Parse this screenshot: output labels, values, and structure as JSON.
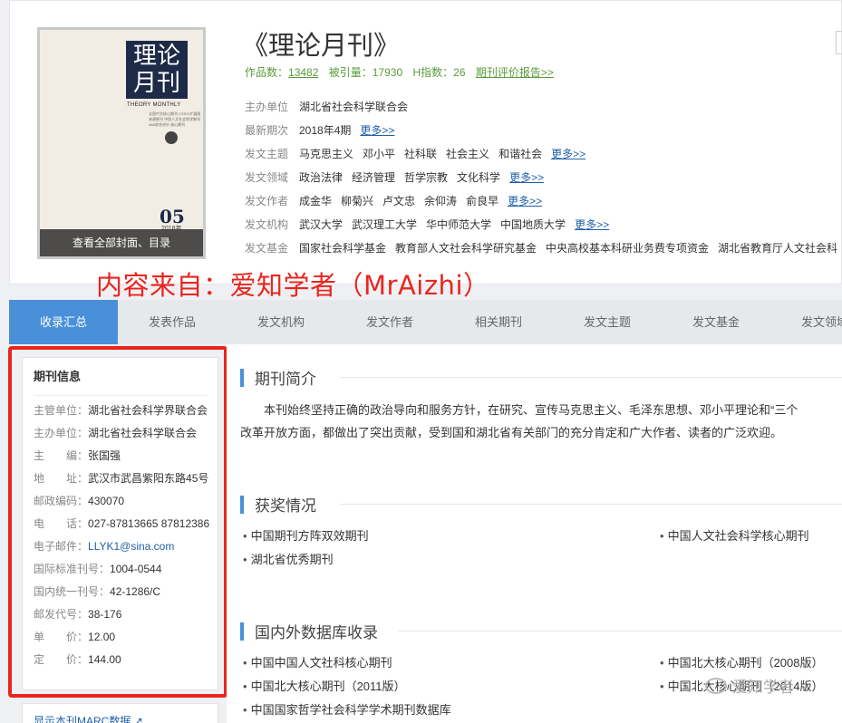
{
  "journal": {
    "title": "《理论月刊》",
    "stats": {
      "works_label": "作品数：",
      "works_value": "13482",
      "citations_label": "被引量：",
      "citations_value": "17930",
      "hindex_label": "H指数：",
      "hindex_value": "26",
      "report_link": "期刊评价报告>>"
    },
    "cover": {
      "chinese_title": "理论月刊",
      "english_title": "THEORY MONTHLY",
      "tiny_text": "全国中文核心期刊 CSSCI扩展版来源期刊 中国人文社会科学期刊AMI综合评价 核心期刊",
      "issue": "05",
      "year": "2018年",
      "overlay_text": "查看全部封面、目录"
    }
  },
  "meta_rows": [
    {
      "label": "主办单位",
      "values": [
        "湖北省社会科学联合会"
      ],
      "more": ""
    },
    {
      "label": "最新期次",
      "values": [
        "2018年4期"
      ],
      "more": "更多>>"
    },
    {
      "label": "发文主题",
      "values": [
        "马克思主义",
        "邓小平",
        "社科联",
        "社会主义",
        "和谐社会"
      ],
      "more": "更多>>"
    },
    {
      "label": "发文领域",
      "values": [
        "政治法律",
        "经济管理",
        "哲学宗教",
        "文化科学"
      ],
      "more": "更多>>"
    },
    {
      "label": "发文作者",
      "values": [
        "成金华",
        "柳菊兴",
        "卢文忠",
        "余仰涛",
        "俞良早"
      ],
      "more": "更多>>"
    },
    {
      "label": "发文机构",
      "values": [
        "武汉大学",
        "武汉理工大学",
        "华中师范大学",
        "中国地质大学"
      ],
      "more": "更多>>"
    },
    {
      "label": "发文基金",
      "values": [
        "国家社会科学基金",
        "教育部人文社会科学研究基金",
        "中央高校基本科研业务费专项资金",
        "湖北省教育厅人文社会科"
      ],
      "more": ""
    }
  ],
  "red_caption": "内容来自：爱知学者（MrAizhi）",
  "tabs": [
    "收录汇总",
    "发表作品",
    "发文机构",
    "发文作者",
    "相关期刊",
    "发文主题",
    "发文基金",
    "发文领域"
  ],
  "sidebar": {
    "heading": "期刊信息",
    "rows": [
      {
        "k": "主管单位：",
        "v": "湖北省社会科学界联合会"
      },
      {
        "k": "主办单位：",
        "v": "湖北省社会科学联合会"
      },
      {
        "k": "主　　编：",
        "v": "张国强"
      },
      {
        "k": "地　　址：",
        "v": "武汉市武昌紫阳东路45号"
      },
      {
        "k": "邮政编码：",
        "v": "430070"
      },
      {
        "k": "电　　话：",
        "v": "027-87813665 87812386"
      },
      {
        "k": "电子邮件：",
        "v": "LLYK1@sina.com"
      },
      {
        "k": "国际标准刊号：",
        "v": "1004-0544"
      },
      {
        "k": "国内统一刊号：",
        "v": "42-1286/C"
      },
      {
        "k": "邮发代号：",
        "v": "38-176"
      },
      {
        "k": "单　　价：",
        "v": "12.00"
      },
      {
        "k": "定　　价：",
        "v": "144.00"
      }
    ],
    "marc_link": "显示本刊MARC数据"
  },
  "main": {
    "intro_heading": "期刊简介",
    "intro_line1": "本刊始终坚持正确的政治导向和服务方针，在研究、宣传马克思主义、毛泽东思想、邓小平理论和“三个",
    "intro_line2": "改革开放方面，都做出了突出贡献，受到国和湖北省有关部门的充分肯定和广大作者、读者的广泛欢迎。",
    "awards_heading": "获奖情况",
    "awards": [
      "中国期刊方阵双效期刊",
      "中国人文社会科学核心期刊",
      "湖北省优秀期刊"
    ],
    "db_heading": "国内外数据库收录",
    "db": [
      "中国中国人文社科核心期刊",
      "中国北大核心期刊（2008版）",
      "中国北大核心期刊（2011版）",
      "中国北大核心期刊（2014版）",
      "中国国家哲学社会科学学术期刊数据库"
    ]
  },
  "wechat_watermark": "爱知学者"
}
